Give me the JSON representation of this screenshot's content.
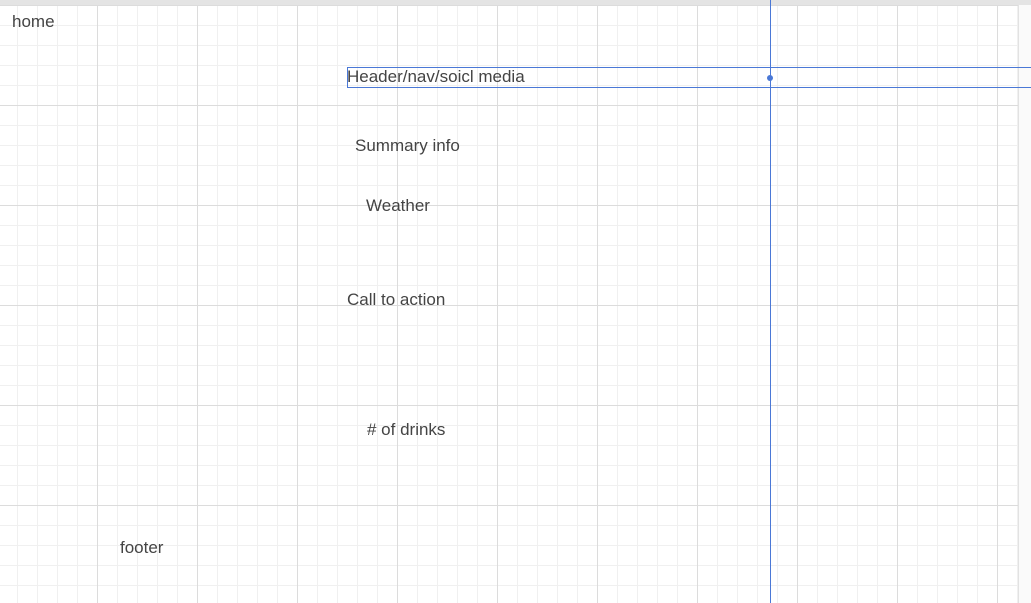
{
  "canvas": {
    "items": {
      "home": "home",
      "header": "Header/nav/soicl media",
      "summary": "Summary info",
      "weather": "Weather",
      "cta": "Call to action",
      "drinks": "# of drinks",
      "footer": "footer"
    }
  },
  "colors": {
    "selection_accent": "#4a78d6",
    "text": "#444444",
    "grid_major": "#dcdcdc",
    "grid_minor": "#f0f0f0"
  },
  "icons": {
    "anchor": "selection-anchor-icon"
  }
}
